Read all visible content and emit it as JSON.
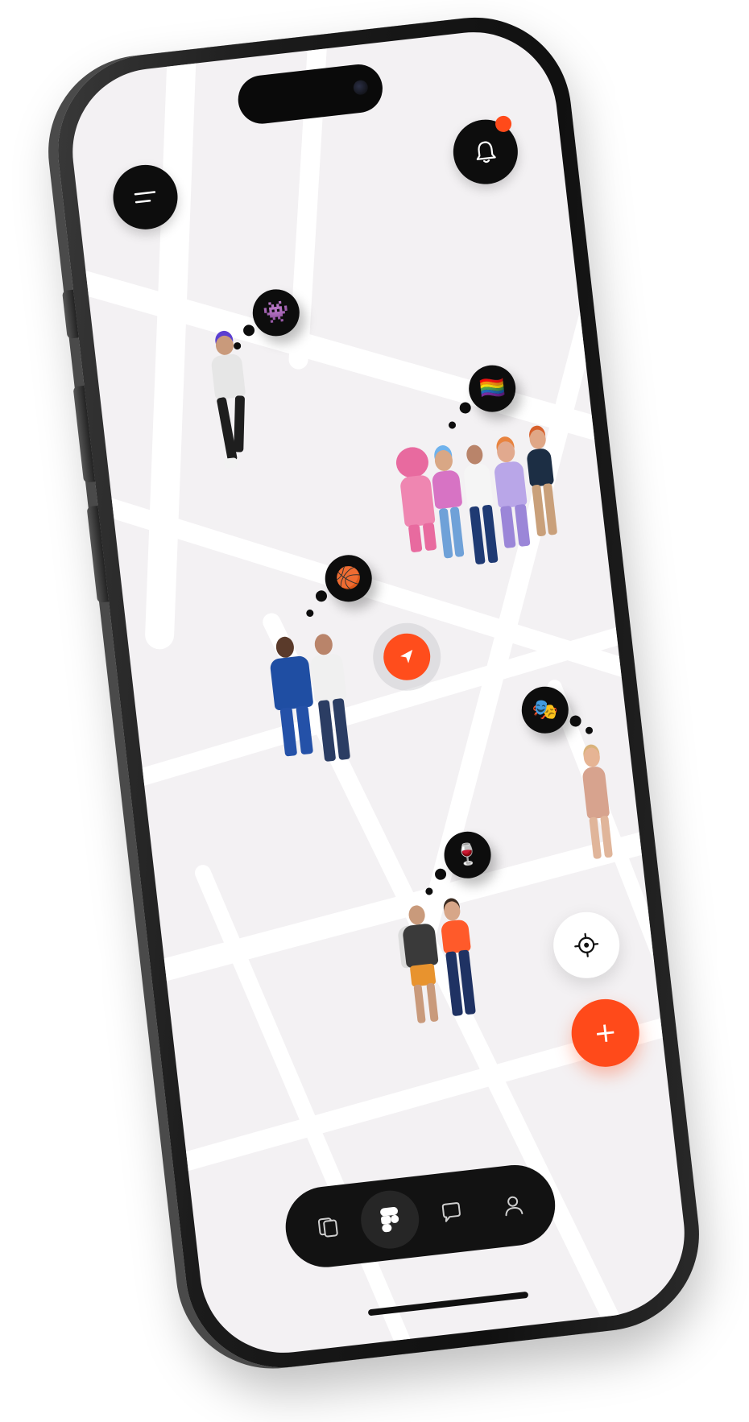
{
  "app": {
    "accent_color": "#ff4a1a",
    "screen_bg": "#f3f1f3"
  },
  "header": {
    "menu_icon": "menu-icon",
    "notifications_icon": "bell-icon",
    "has_unread_notifications": true
  },
  "map": {
    "groups": [
      {
        "id": "gaming",
        "icon_name": "space-invader-icon",
        "glyph": "👾",
        "members": 1
      },
      {
        "id": "pride",
        "icon_name": "rainbow-flag-icon",
        "glyph": "🏳️‍🌈",
        "members": 5
      },
      {
        "id": "basketball",
        "icon_name": "basketball-icon",
        "glyph": "🏀",
        "members": 2
      },
      {
        "id": "theater",
        "icon_name": "theater-masks-icon",
        "glyph": "🎭",
        "members": 1
      },
      {
        "id": "wine",
        "icon_name": "wine-glass-icon",
        "glyph": "🍷",
        "members": 2
      }
    ],
    "my_location_icon": "navigation-arrow-icon"
  },
  "actions": {
    "recenter_icon": "crosshair-icon",
    "add_label": "+"
  },
  "tabbar": {
    "tabs": [
      {
        "id": "cards",
        "icon_name": "cards-icon",
        "active": false
      },
      {
        "id": "map",
        "icon_name": "app-logo-icon",
        "active": true
      },
      {
        "id": "chat",
        "icon_name": "chat-bubble-icon",
        "active": false
      },
      {
        "id": "profile",
        "icon_name": "profile-icon",
        "active": false
      }
    ]
  }
}
